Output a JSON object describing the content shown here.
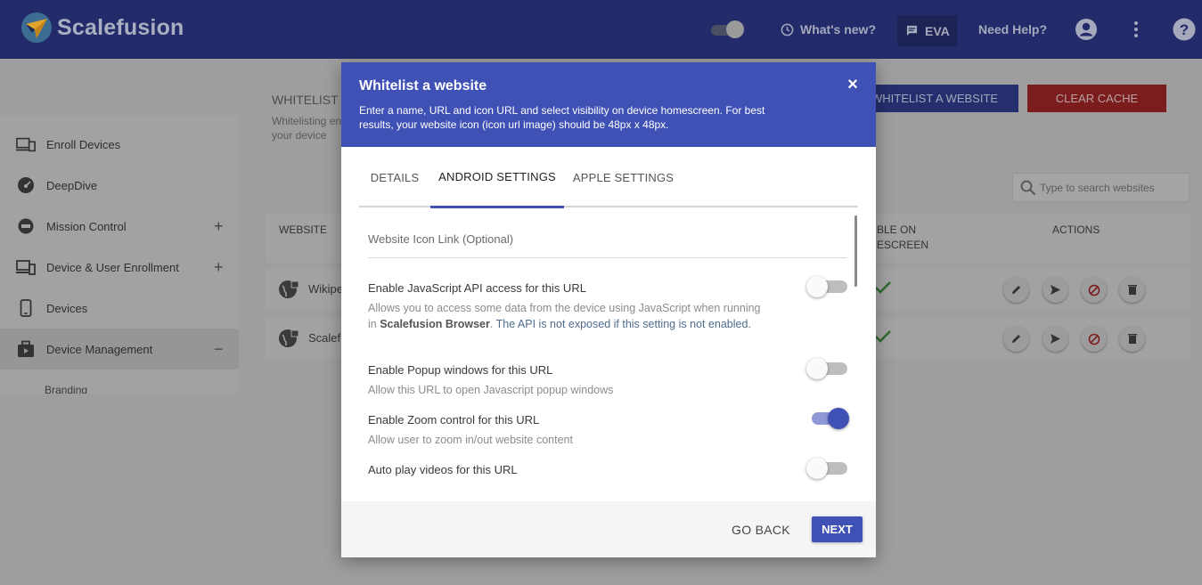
{
  "app": {
    "brand": "Scalefusion",
    "colors": {
      "header": "#3f51b5",
      "accent": "#3f51b5",
      "danger": "#c62828",
      "check": "#2e7d32"
    }
  },
  "topbar": {
    "whats_new": "What's new?",
    "eva": "EVA",
    "need_help": "Need Help?",
    "icons": [
      "clock-icon",
      "chat-icon",
      "account-icon",
      "more-vert-icon",
      "help-icon"
    ]
  },
  "sidebar": {
    "items": [
      {
        "label": "Enroll Devices",
        "icon": "enroll-devices-icon"
      },
      {
        "label": "DeepDive",
        "icon": "speedometer-icon"
      },
      {
        "label": "Mission Control",
        "icon": "mission-control-icon",
        "expand": "+"
      },
      {
        "label": "Device & User Enrollment",
        "icon": "devices-icon",
        "expand": "+"
      },
      {
        "label": "Devices",
        "icon": "phone-icon"
      },
      {
        "label": "Device Management",
        "icon": "briefcase-icon",
        "expand": "−"
      }
    ],
    "sub_item": "Branding"
  },
  "page": {
    "heading": "WHITELIST W",
    "desc": "Whitelisting en your device",
    "whitelist_button": "WHITELIST A WEBSITE",
    "clear_cache_button": "CLEAR CACHE",
    "search_placeholder": "Type to search websites",
    "table": {
      "headers": {
        "website": "WEBSITE",
        "visible": "BLE ON ESCREEN",
        "actions": "ACTIONS"
      },
      "rows": [
        {
          "name": "Wikipe"
        },
        {
          "name": "Scalefu"
        }
      ]
    }
  },
  "modal": {
    "title": "Whitelist a website",
    "subtitle": "Enter a name, URL and icon URL and select visibility on device homescreen. For best results, your website icon (icon url image) should be 48px x 48px.",
    "tabs": [
      "DETAILS",
      "ANDROID SETTINGS",
      "APPLE SETTINGS"
    ],
    "active_tab": "ANDROID SETTINGS",
    "icon_link_placeholder": "Website Icon Link (Optional)",
    "settings": {
      "js_api": {
        "title": "Enable JavaScript API access for this URL",
        "desc_pre": "Allows you to access some data from the device using JavaScript when running in",
        "desc_brand": "Scalefusion Browser",
        "desc_note": "The API is not exposed if this setting is not",
        "desc_end": "enabled.",
        "enabled": false
      },
      "popup": {
        "title": "Enable Popup windows for this URL",
        "desc": "Allow this URL to open Javascript popup windows",
        "enabled": false
      },
      "zoom": {
        "title": "Enable Zoom control for this URL",
        "desc": "Allow user to zoom in/out website content",
        "enabled": true
      },
      "autoplay": {
        "title": "Auto play videos for this URL",
        "enabled": false
      }
    },
    "go_back": "GO BACK",
    "next": "NEXT"
  }
}
